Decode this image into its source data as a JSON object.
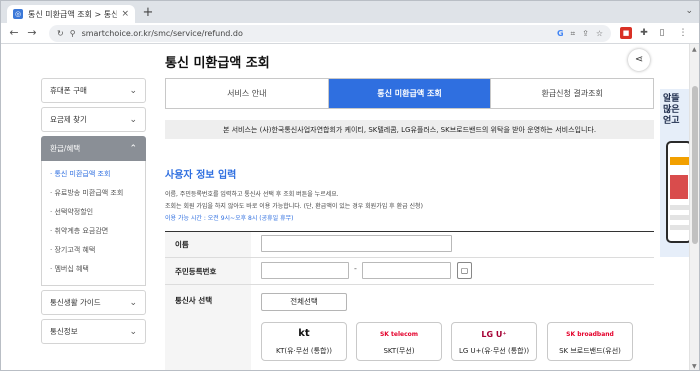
{
  "browser": {
    "tab_title": "통신 미환급액 조회 > 통신 미환급",
    "tab_close": "×",
    "new_tab": "+",
    "tab_menu": "⌄",
    "url": "smartchoice.or.kr/smc/service/refund.do",
    "icons": [
      "back-icon",
      "forward-icon",
      "reload-icon",
      "site-info-icon",
      "google-lens-icon",
      "translate-icon",
      "share-icon",
      "bookmark-star-icon",
      "extension-red-icon",
      "extensions-puzzle-icon",
      "side-panel-icon",
      "more-menu-icon"
    ]
  },
  "page": {
    "title": "통신 미환급액 조회",
    "share_icon": "share-icon"
  },
  "sidebar": {
    "items": [
      {
        "label": "휴대폰 구매",
        "chevron": "⌄"
      },
      {
        "label": "요금제 찾기",
        "chevron": "⌄"
      },
      {
        "label": "환급/혜택",
        "chevron": "⌃",
        "active": true
      },
      {
        "label": "통신생활 가이드",
        "chevron": "⌄"
      },
      {
        "label": "통신정보",
        "chevron": "⌄"
      }
    ],
    "sub_items": [
      "· 통신 미환급액 조회",
      "· 유료방송 미환급액 조회",
      "· 선택약정할인",
      "· 취약계층 요금감면",
      "· 장기고객 혜택",
      "· 멤버십 혜택"
    ]
  },
  "tabs": [
    "서비스 안내",
    "통신 미환급액 조회",
    "환급신청 결과조회"
  ],
  "notice": "본 서비스는 (사)한국통신사업자연합회가 케이티, SK텔레콤, LG유플러스, SK브로드밴드의 위탁을 받아 운영하는 서비스입니다.",
  "section": {
    "title": "사용자 정보 입력",
    "desc1": "이름, 주민등록번호를 입력하고 통신사 선택 후 조회 버튼을 누르세요.",
    "desc2": "조회는 회원 가입을 하지 않아도 바로 이용 가능합니다. (단, 환급액이 있는 경우 회원가입 후 환급 신청)",
    "desc3": "이용 가능 시간 : 오전 9시~오후 8시 (공휴일 휴무)"
  },
  "form": {
    "name_label": "이름",
    "rrn_label": "주민등록번호",
    "rrn_dash": "-",
    "keypad_icon": "mouse-keypad-icon",
    "carrier_label": "통신사 선택",
    "select_all": "전체선택"
  },
  "carriers": [
    {
      "logo": "kt",
      "label": "KT(유·무선 (통합))",
      "color": "#111111"
    },
    {
      "logo": "SK telecom",
      "label": "SKT(무선)",
      "color": "#e4002b"
    },
    {
      "logo": "LG U⁺",
      "label": "LG U+(유·무선 (통합))",
      "color": "#a50034"
    },
    {
      "logo": "SK broadband",
      "label": "SK 브로드밴드(유선)",
      "color": "#e4002b"
    }
  ],
  "ad": {
    "text": "알뜰\n많은\n얻고"
  },
  "colors": {
    "accent": "#2f6fe0",
    "active_side": "#8a8f96"
  }
}
